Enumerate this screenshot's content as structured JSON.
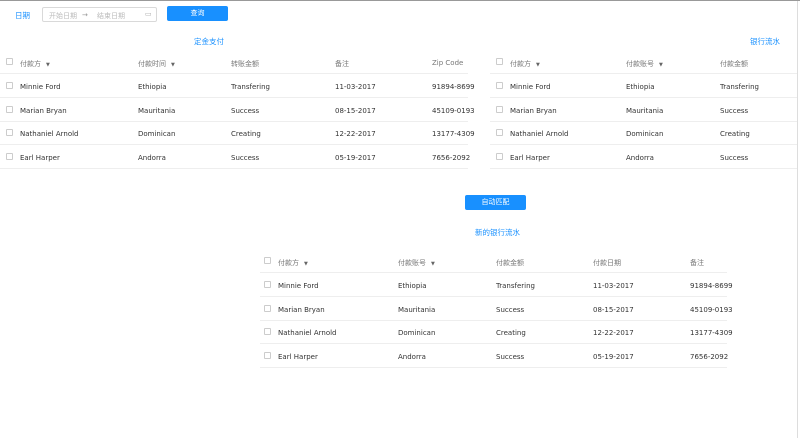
{
  "filter": {
    "label": "日期",
    "start_placeholder": "开始日期",
    "arrow": "→",
    "end_placeholder": "结束日期",
    "query_button": "查询"
  },
  "deposit": {
    "title": "定金支付",
    "columns": [
      {
        "label": "付款方",
        "sort": true
      },
      {
        "label": "付款时间",
        "sort": true
      },
      {
        "label": "转账金额"
      },
      {
        "label": "备注"
      },
      {
        "label": "Zip Code"
      }
    ],
    "rows": [
      [
        "Minnie Ford",
        "Ethiopia",
        "Transfering",
        "11-03-2017",
        "91894-8699"
      ],
      [
        "Marian Bryan",
        "Mauritania",
        "Success",
        "08-15-2017",
        "45109-0193"
      ],
      [
        "Nathaniel Arnold",
        "Dominican",
        "Creating",
        "12-22-2017",
        "13177-4309"
      ],
      [
        "Earl Harper",
        "Andorra",
        "Success",
        "05-19-2017",
        "7656-2092"
      ]
    ]
  },
  "bank": {
    "title": "银行流水",
    "columns": [
      {
        "label": "付款方",
        "sort": true
      },
      {
        "label": "付款账号",
        "sort": true
      },
      {
        "label": "付款金额"
      }
    ],
    "rows": [
      [
        "Minnie Ford",
        "Ethiopia",
        "Transfering"
      ],
      [
        "Marian Bryan",
        "Mauritania",
        "Success"
      ],
      [
        "Nathaniel Arnold",
        "Dominican",
        "Creating"
      ],
      [
        "Earl Harper",
        "Andorra",
        "Success"
      ]
    ]
  },
  "auto_match_button": "自动匹配",
  "new_bank": {
    "title": "新的银行流水",
    "columns": [
      {
        "label": "付款方",
        "sort": true
      },
      {
        "label": "付款账号",
        "sort": true
      },
      {
        "label": "付款金额"
      },
      {
        "label": "付款日期"
      },
      {
        "label": "备注"
      }
    ],
    "rows": [
      [
        "Minnie Ford",
        "Ethiopia",
        "Transfering",
        "11-03-2017",
        "91894-8699"
      ],
      [
        "Marian Bryan",
        "Mauritania",
        "Success",
        "08-15-2017",
        "45109-0193"
      ],
      [
        "Nathaniel Arnold",
        "Dominican",
        "Creating",
        "12-22-2017",
        "13177-4309"
      ],
      [
        "Earl Harper",
        "Andorra",
        "Success",
        "05-19-2017",
        "7656-2092"
      ]
    ]
  }
}
